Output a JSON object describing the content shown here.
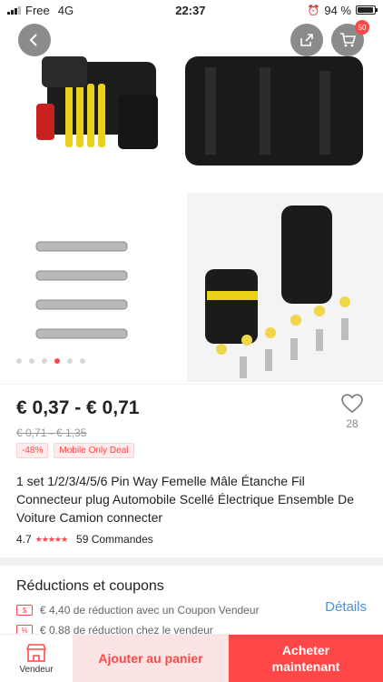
{
  "status_bar": {
    "carrier": "Free",
    "network": "4G",
    "time": "22:37",
    "battery": "94 %",
    "battery_level": 0.94
  },
  "gallery": {
    "image_count": 6,
    "active_index": 3,
    "cart_count": "50"
  },
  "product": {
    "price": "€ 0,37 - € 0,71",
    "old_price": "€ 0,71 - € 1,35",
    "discount_badge": "-48%",
    "deal_badge": "Mobile Only Deal",
    "wish_count": "28",
    "title": "1 set 1/2/3/4/5/6 Pin Way Femelle Mâle Étanche Fil Connecteur plug Automobile Scellé Électrique Ensemble De Voiture Camion connecter",
    "rating": "4.7",
    "stars": "★★★★★",
    "orders": "59 Commandes"
  },
  "coupons": {
    "title": "Réductions et coupons",
    "icon_1": "$",
    "row_1": "€ 4,40 de réduction avec un Coupon Vendeur",
    "icon_2": "%",
    "row_2": "€ 0.88 de réduction chez le vendeur",
    "details": "Détails"
  },
  "bottom_bar": {
    "seller_label": "Vendeur",
    "add_to_cart": "Ajouter au panier",
    "buy_now": "Acheter\nmaintenant"
  },
  "colors": {
    "accent": "#ff4747",
    "link": "#4a90e2"
  }
}
